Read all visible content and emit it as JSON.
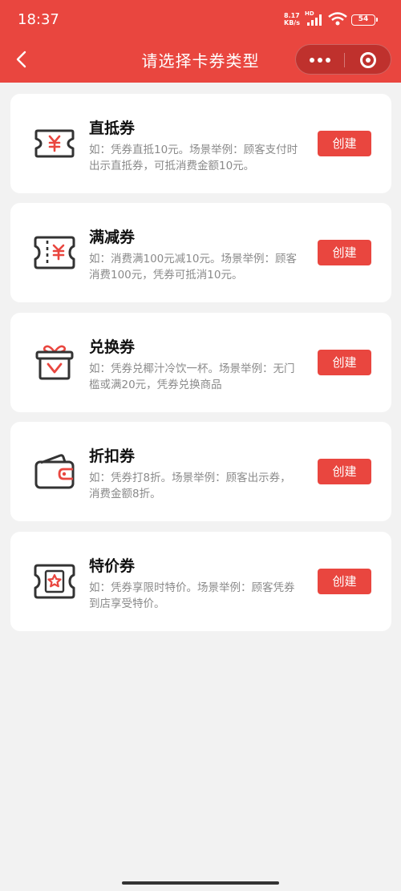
{
  "status_bar": {
    "time": "18:37",
    "net_speed": "8.17",
    "net_unit": "KB/s",
    "hd": "HD",
    "battery": "54"
  },
  "nav": {
    "title": "请选择卡券类型"
  },
  "colors": {
    "accent": "#e9463f",
    "background": "#f2f2f2",
    "card": "#ffffff",
    "desc_text": "#8a8a8a"
  },
  "coupon_types": [
    {
      "name": "直抵券",
      "icon": "yuan-ticket-icon",
      "desc": "如：凭券直抵10元。场景举例：顾客支付时出示直抵券，可抵消费金额10元。",
      "button": "创建"
    },
    {
      "name": "满减券",
      "icon": "dashed-yuan-ticket-icon",
      "desc": "如：消费满100元减10元。场景举例：顾客消费100元，凭券可抵消10元。",
      "button": "创建"
    },
    {
      "name": "兑换券",
      "icon": "gift-box-icon",
      "desc": "如：凭券兑椰汁冷饮一杯。场景举例：无门槛或满20元，凭券兑换商品",
      "button": "创建"
    },
    {
      "name": "折扣券",
      "icon": "wallet-icon",
      "desc": "如：凭券打8折。场景举例：顾客出示券，消费金额8折。",
      "button": "创建"
    },
    {
      "name": "特价券",
      "icon": "star-ticket-icon",
      "desc": "如：凭券享限时特价。场景举例：顾客凭券到店享受特价。",
      "button": "创建"
    }
  ]
}
